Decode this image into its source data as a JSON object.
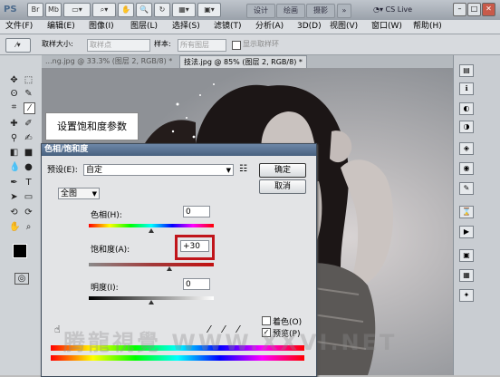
{
  "titlebar": {
    "logo": "PS",
    "workspace_buttons": [
      "设计",
      "绘画",
      "摄影"
    ],
    "cs_live": "CS Live"
  },
  "menu": [
    "文件(F)",
    "编辑(E)",
    "图像(I)",
    "图层(L)",
    "选择(S)",
    "滤镜(T)",
    "分析(A)",
    "3D(D)",
    "视图(V)",
    "窗口(W)",
    "帮助(H)"
  ],
  "options": {
    "sample_size_label": "取样大小:",
    "sample_size_value": "取样点",
    "sample_label": "样本:",
    "sample_value": "所有图层",
    "show_ring": "显示取样环"
  },
  "tabs": [
    {
      "label": "...ng.jpg @ 33.3% (图层 2, RGB/8) *"
    },
    {
      "label": "技法.jpg @ 85% (图层 2, RGB/8) *"
    }
  ],
  "callout": "设置饱和度参数",
  "dialog": {
    "title": "色相/饱和度",
    "preset_label": "预设(E):",
    "preset_value": "自定",
    "ok": "确定",
    "cancel": "取消",
    "channel": "全图",
    "hue_label": "色相(H):",
    "hue_value": "0",
    "saturation_label": "饱和度(A):",
    "saturation_value": "+30",
    "lightness_label": "明度(I):",
    "lightness_value": "0",
    "colorize_label": "着色(O)",
    "preview_label": "预览(P)",
    "colorize_checked": false,
    "preview_checked": true
  },
  "watermark": "腾龍視覺 WWW.XXVI.NET",
  "colors": {
    "highlight": "#c0141a",
    "title_gradient_top": "#6d87a8"
  }
}
